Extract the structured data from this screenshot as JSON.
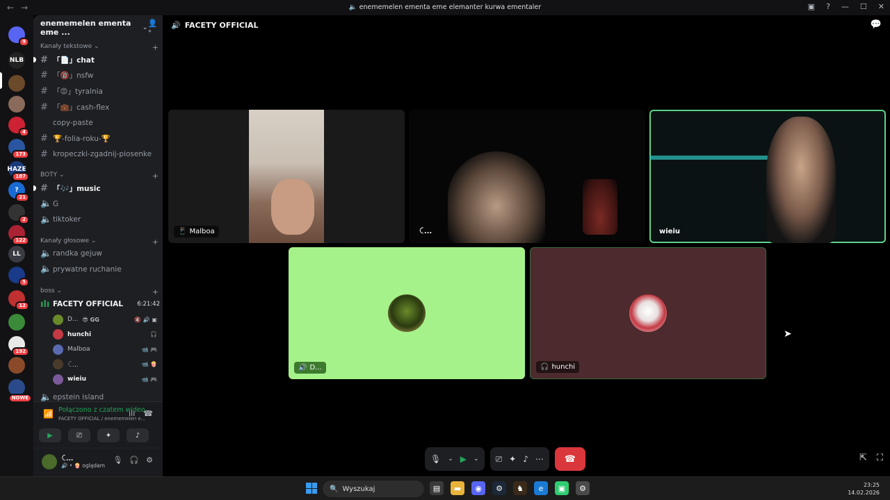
{
  "window": {
    "title": "enememelen ementa eme elemanter kurwa ementaler",
    "back": "←",
    "forward": "→"
  },
  "servers": [
    {
      "icon": "discord-home-icon",
      "label": "",
      "badge": "9"
    },
    {
      "icon": "server-nlb",
      "label": "NLB",
      "badge": ""
    },
    {
      "icon": "server-2",
      "label": "",
      "badge": ""
    },
    {
      "icon": "server-3",
      "label": "",
      "badge": ""
    },
    {
      "icon": "server-4",
      "label": "",
      "badge": "4"
    },
    {
      "icon": "server-5",
      "label": "",
      "badge": "173"
    },
    {
      "icon": "server-haze",
      "label": "HAZE",
      "badge": "187"
    },
    {
      "icon": "server-7",
      "label": "?",
      "badge": "21"
    },
    {
      "icon": "server-8",
      "label": "",
      "badge": "2"
    },
    {
      "icon": "server-9",
      "label": "",
      "badge": "122"
    },
    {
      "icon": "server-ll",
      "label": "LL",
      "badge": ""
    },
    {
      "icon": "server-11",
      "label": "",
      "badge": "5"
    },
    {
      "icon": "server-12",
      "label": "",
      "badge": "12"
    },
    {
      "icon": "server-pepe",
      "label": "",
      "badge": ""
    },
    {
      "icon": "server-14",
      "label": "",
      "badge": "192"
    },
    {
      "icon": "server-15",
      "label": "",
      "badge": ""
    },
    {
      "icon": "server-16",
      "label": "",
      "badge": "NOWE"
    }
  ],
  "guild": {
    "name": "enememelen ementa eme ...",
    "categories": {
      "text": "Kanały tekstowe",
      "bots": "BOTY",
      "voice": "Kanały głosowe",
      "boss": "boss"
    },
    "text_channels": [
      {
        "name": "「📄」chat",
        "bright": true
      },
      {
        "name": "「🔞」nsfw",
        "bright": false
      },
      {
        "name": "「😡」tyralnia",
        "bright": false
      },
      {
        "name": "「💼」cash-flex",
        "bright": false
      },
      {
        "name": "copy-paste",
        "bright": false
      },
      {
        "name": "🏆-folia-roku-🏆",
        "bright": false
      },
      {
        "name": "kropeczki-zgadnij-piosenke",
        "bright": false
      }
    ],
    "bot_channels": [
      {
        "name": "「🎶」music",
        "bright": true,
        "kind": "text"
      },
      {
        "name": "G",
        "bright": false,
        "kind": "voice"
      },
      {
        "name": "tiktoker",
        "bright": false,
        "kind": "voice"
      }
    ],
    "voice_channels": [
      {
        "name": "randka gejuw"
      },
      {
        "name": "prywatne ruchanie"
      }
    ],
    "active_voice": {
      "name": "FACETY OFFICIAL",
      "timer": "6:21:42",
      "users": [
        {
          "name": "D...",
          "extra": "😎 GG",
          "bold": false,
          "icons": "🔇 🔊 ▣"
        },
        {
          "name": "hunchi",
          "extra": "",
          "bold": true,
          "icons": "🎧"
        },
        {
          "name": "Malboa",
          "extra": "",
          "bold": false,
          "icons": "📹 🎮"
        },
        {
          "name": "ꉔ...",
          "extra": "",
          "bold": false,
          "icons": "📹 🍿"
        },
        {
          "name": "wieiu",
          "extra": "",
          "bold": true,
          "icons": "📹 🎮"
        }
      ]
    },
    "after_voice": "epstein island"
  },
  "voice_panel": {
    "status": "Połączono z czatem wideo",
    "sub": "FACETY OFFICIAL / enememelen e..."
  },
  "user_panel": {
    "name": "ꉔ...",
    "status": "🔊 • 🍿 oglądam"
  },
  "stage": {
    "title": "FACETY OFFICIAL",
    "tiles": [
      {
        "label": "Malboa",
        "icon": "📱"
      },
      {
        "label": "ꉔ...",
        "icon": ""
      },
      {
        "label": "wieiu",
        "icon": ""
      },
      {
        "label": "D...",
        "icon": "🔊"
      },
      {
        "label": "hunchi",
        "icon": "🎧"
      }
    ]
  },
  "taskbar": {
    "search": "Wyszukaj",
    "time": "23:25",
    "date": "14.02.2026"
  },
  "colors": {
    "accent_green": "#23a55a",
    "end_call": "#da373c",
    "tile_green": "#a5f28a",
    "tile_maroon": "#4d2a2d"
  }
}
